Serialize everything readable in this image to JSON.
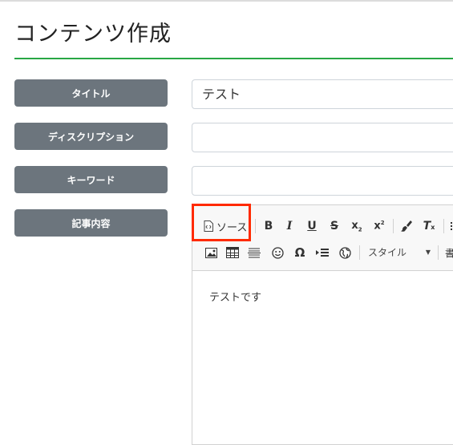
{
  "page": {
    "title": "コンテンツ作成"
  },
  "form": {
    "title_label": "タイトル",
    "title_value": "テスト",
    "description_label": "ディスクリプション",
    "description_value": "",
    "keywords_label": "キーワード",
    "keywords_value": "",
    "content_label": "記事内容"
  },
  "editor": {
    "source_label": "ソース",
    "style_label": "スタイル",
    "format_partial": "書",
    "body_text": "テストです",
    "toolbar_row1_icons": [
      "source-icon",
      "bold-icon",
      "italic-icon",
      "underline-icon",
      "strike-icon",
      "subscript-icon",
      "superscript-icon",
      "copy-format-icon",
      "remove-format-icon"
    ],
    "toolbar_row2_icons": [
      "image-icon",
      "table-icon",
      "horizontal-line-icon",
      "smiley-icon",
      "special-char-icon",
      "page-break-icon",
      "iframe-icon"
    ]
  },
  "colors": {
    "label_bg": "#6c757d",
    "title_rule": "#28a745",
    "highlight": "#ff2a00"
  }
}
